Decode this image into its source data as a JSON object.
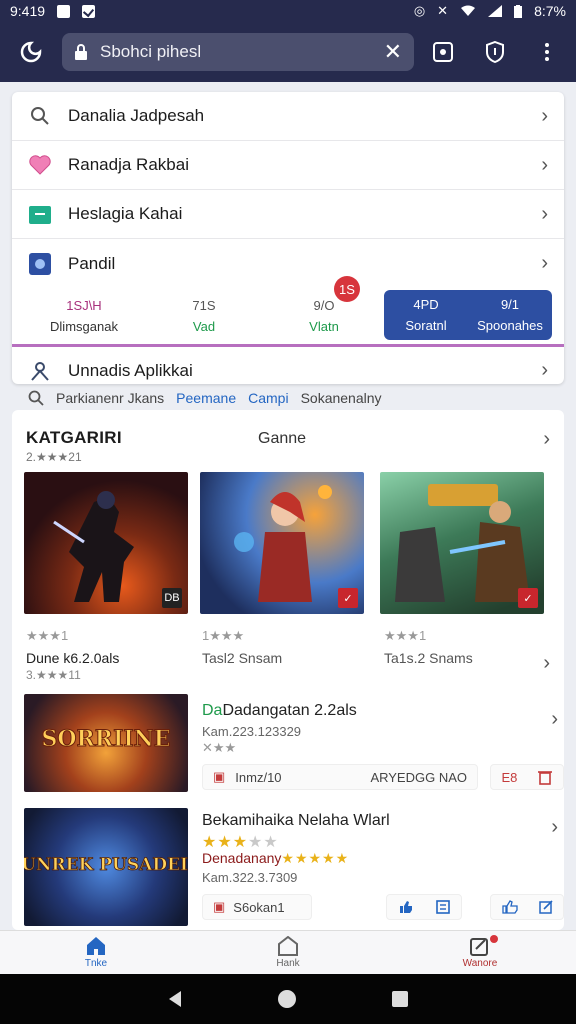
{
  "status_bar": {
    "time": "9:419",
    "battery": "8:7%"
  },
  "url_bar": {
    "url": "Sbohci pihesl"
  },
  "suggestions": [
    {
      "label": "Danalia Jadpesah",
      "icon": "search-icon"
    },
    {
      "label": "Ranadja Rakbai",
      "icon": "heart-icon"
    },
    {
      "label": "Heslagia Kahai",
      "icon": "folder-icon"
    },
    {
      "label": "Pandil",
      "icon": "app-icon"
    }
  ],
  "stats": [
    {
      "value": "1SJ\\H",
      "label": "Dlimsganak"
    },
    {
      "value": "71S",
      "label": "Vad"
    },
    {
      "value": "9/O",
      "label": "Vlatn"
    },
    {
      "value": "4PD",
      "label": "Soratnl"
    },
    {
      "value": "9/1",
      "label": "Spoonahes"
    }
  ],
  "stats_badge": "1S",
  "install_row": {
    "label": "Unnadis Aplikkai",
    "icon": "person-icon"
  },
  "filter_line": {
    "text": "Parkianenr Jkans",
    "link1": "Peemane",
    "link2": "Campi",
    "text2": "Sokanenalny"
  },
  "category": {
    "title": "KATGARIRI",
    "subtitle": "2.★★★21",
    "tab": "Ganne",
    "grid": [
      {
        "rating": "★★★1",
        "title": "Dune k6.2.0als",
        "sub": "3.★★★11",
        "badge": "DB"
      },
      {
        "rating": "1★★★",
        "title": "Tasl2 Snsam",
        "sub": "",
        "badge": "✓"
      },
      {
        "rating": "★★★1",
        "title": "Ta1s.2 Snams",
        "sub": "",
        "badge": "✓"
      }
    ],
    "list": [
      {
        "title_hl": "Da",
        "title": "Dadangatan 2.2als",
        "meta1": "Kam.223.123329",
        "meta2": "✕★★",
        "bar_left": "Inmz/10",
        "bar_right": "ARYEDGG NAO",
        "btn_left": "E8",
        "btn_right": "Trash",
        "thumb_text": "SORRIINE"
      },
      {
        "title": "Bekamihaika Nelaha Wlarl",
        "stars_label": "★★★",
        "developer": "Denadanany",
        "dev_stars": "★★★★★",
        "meta1": "Kam.322.3.7309",
        "bar_left": "S6okan1",
        "thumb_text": "TUNREK PUSADEIN"
      }
    ]
  },
  "bottom_nav": [
    {
      "label": "Tnke",
      "icon": "home-icon"
    },
    {
      "label": "Hank",
      "icon": "shape-icon"
    },
    {
      "label": "Wanore",
      "icon": "edit-icon"
    }
  ],
  "colors": {
    "header": "#262a4d",
    "accent_blue": "#2d4fa2",
    "accent_green": "#1e9a4b",
    "badge_red": "#d7353c"
  }
}
